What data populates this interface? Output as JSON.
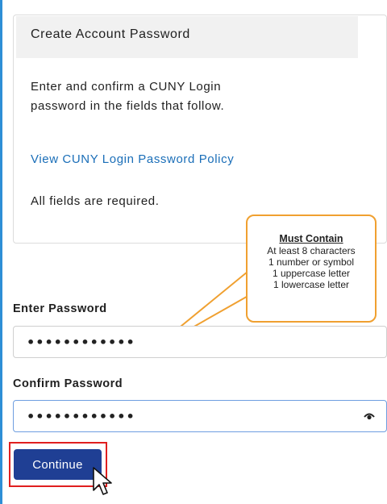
{
  "card": {
    "title": "Create Account Password",
    "instructions_line1": "Enter and confirm a CUNY Login",
    "instructions_line2": "password in the fields that follow.",
    "policy_link": "View CUNY Login Password Policy",
    "required_note": "All fields are required."
  },
  "callout": {
    "title": "Must Contain",
    "rules": [
      "At least 8 characters",
      "1 number or symbol",
      "1 uppercase letter",
      "1 lowercase letter"
    ]
  },
  "form": {
    "password_label": "Enter Password",
    "password_value": "••••••••••••",
    "confirm_label": "Confirm Password",
    "confirm_value": "••••••••••••",
    "continue_label": "Continue"
  },
  "colors": {
    "accent_button": "#1f3f94",
    "link": "#1a6eb8",
    "callout_border": "#f0a030",
    "highlight_box": "#e01f1f"
  },
  "icons": {
    "reveal_password": "eye-icon",
    "mouse_pointer": "cursor-arrow-icon"
  }
}
